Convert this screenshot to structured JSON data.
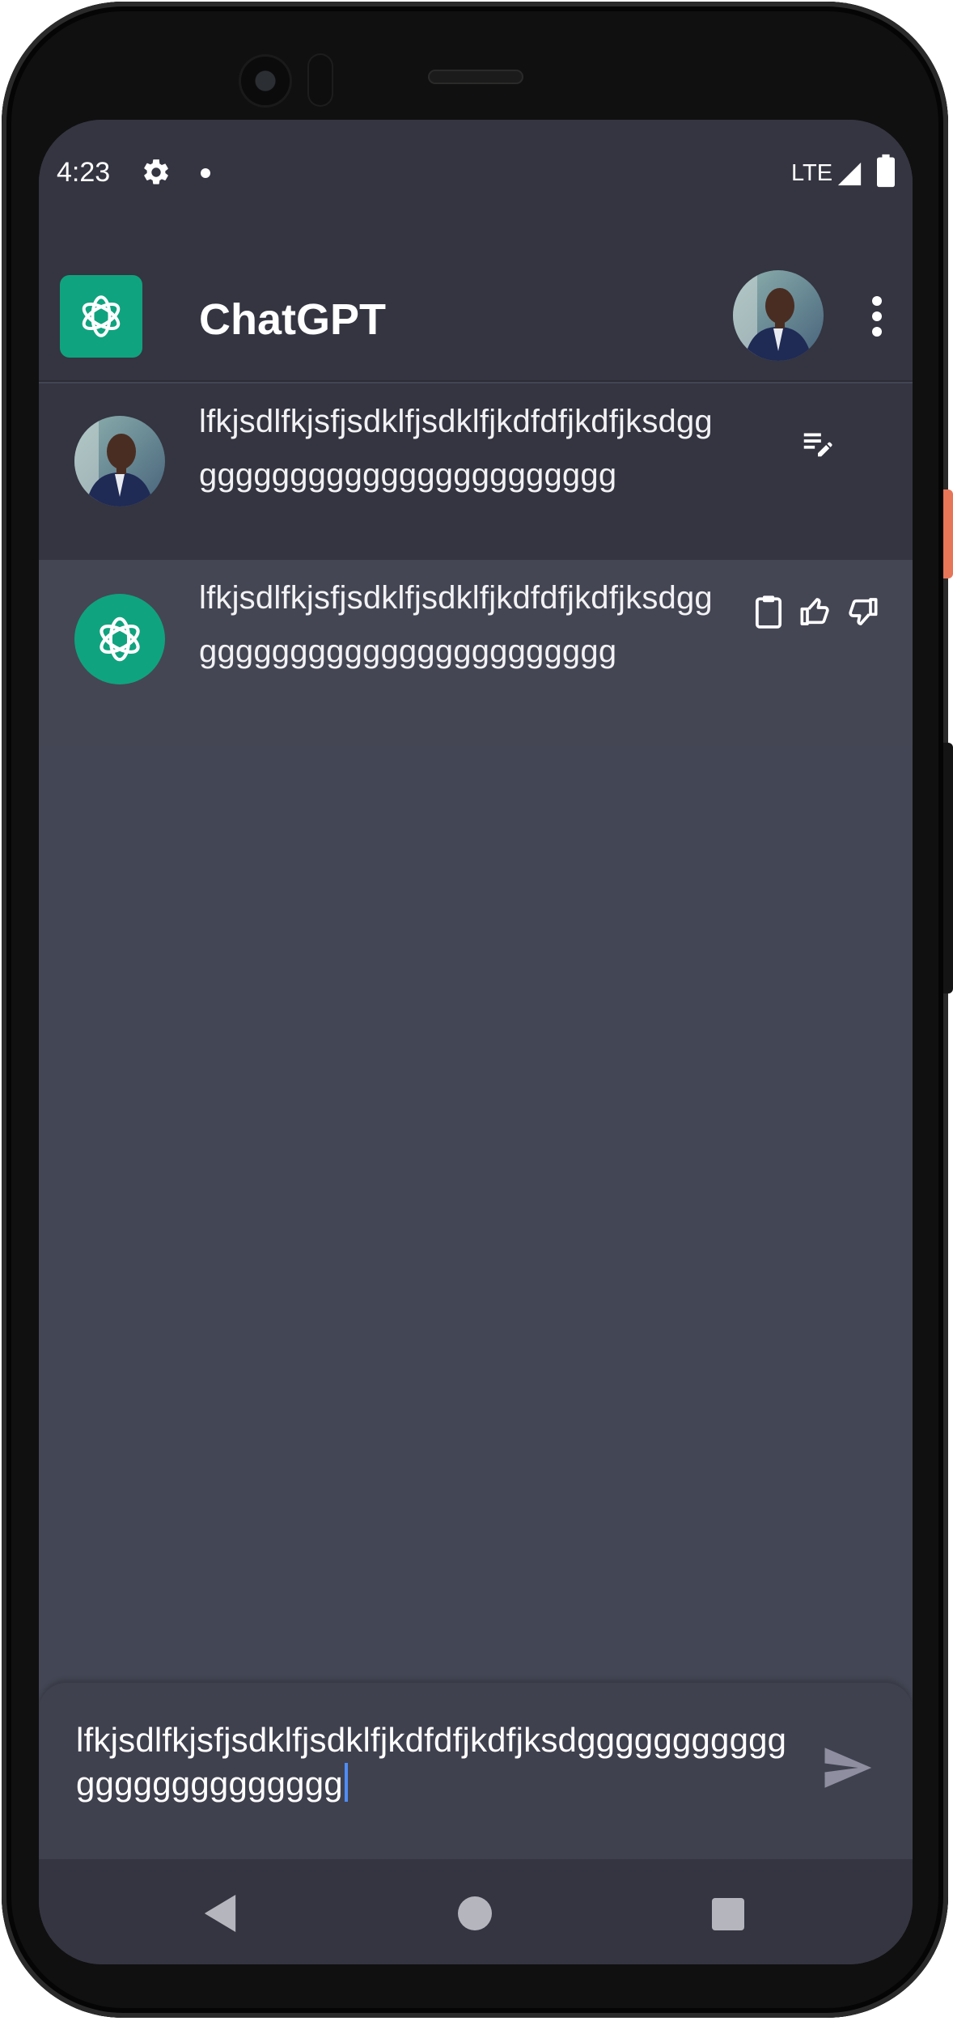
{
  "status_bar": {
    "time": "4:23",
    "network": "LTE",
    "icons": [
      "gear-icon",
      "notification-dot",
      "signal-icon",
      "battery-icon"
    ]
  },
  "app_bar": {
    "title": "ChatGPT",
    "logo_icon": "openai-logo-icon",
    "more_icon": "more-vert-icon"
  },
  "messages": [
    {
      "role": "user",
      "text": "lfkjsdlfkjsfjsdklfjsdklfjkdfdfjkdfjksdggggggggggggggggggggggggg",
      "action_icons": [
        "edit-note-icon"
      ]
    },
    {
      "role": "assistant",
      "text": "lfkjsdlfkjsfjsdklfjsdklfjkdfdfjkdfjksdggggggggggggggggggggggggg",
      "action_icons": [
        "clipboard-icon",
        "thumbs-up-icon",
        "thumbs-down-icon"
      ]
    }
  ],
  "composer": {
    "value": "lfkjsdlfkjsfjsdklfjsdklfjkdfdfjkdfjksdggggggggggggggggggggggggg",
    "send_icon": "send-icon"
  },
  "nav_bar": {
    "icons": [
      "back-icon",
      "home-icon",
      "recents-icon"
    ]
  },
  "colors": {
    "background": "#434654",
    "bar": "#343541",
    "accent": "#10a37f",
    "text": "#ffffff",
    "caret": "#4f8df5"
  }
}
